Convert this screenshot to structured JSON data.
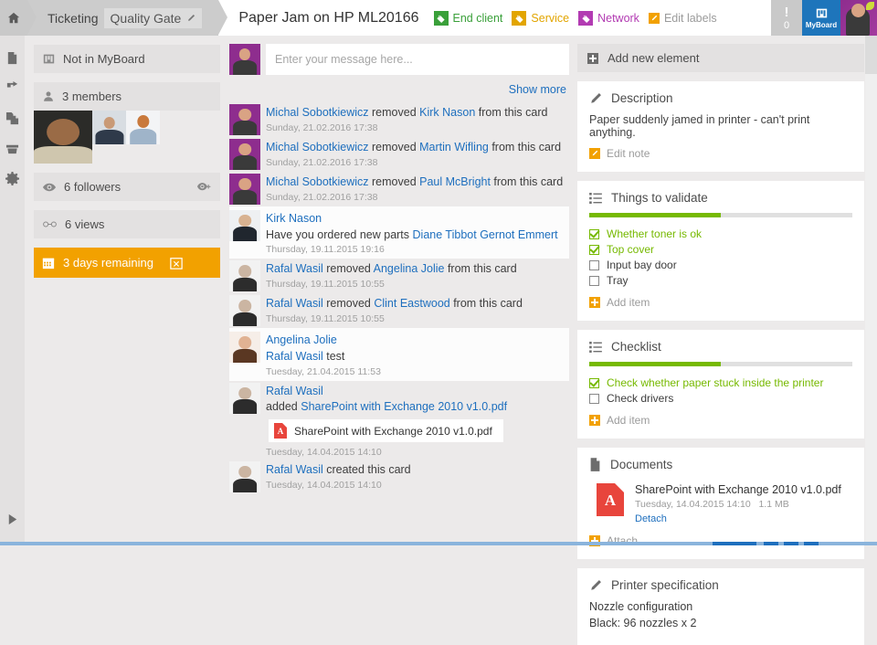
{
  "header": {
    "home_icon": "home-icon",
    "breadcrumb": [
      {
        "label": "Ticketing",
        "type": "plain"
      },
      {
        "label": "Quality Gate",
        "type": "chip",
        "icon": "pencil-icon"
      }
    ],
    "card_title": "Paper Jam on HP ML20166",
    "labels": [
      {
        "text": "End client",
        "color": "#3aa03a",
        "icon": "tag-icon"
      },
      {
        "text": "Service",
        "color": "#e2a500",
        "icon": "tag-icon"
      },
      {
        "text": "Network",
        "color": "#b23bb2",
        "icon": "tag-icon"
      }
    ],
    "edit_labels": {
      "text": "Edit labels",
      "icon": "pencil-icon",
      "color": "#9b9b9b"
    },
    "alerts": {
      "icon": "exclamation-icon",
      "count": "0"
    },
    "myboard": {
      "label": "MyBoard",
      "icon": "board-icon",
      "color": "#1e75bb"
    },
    "user_avatar": "user-avatar"
  },
  "rail": {
    "items": [
      {
        "name": "document-icon"
      },
      {
        "name": "move-arrow-icon"
      },
      {
        "name": "copy-icon"
      },
      {
        "name": "archive-icon"
      },
      {
        "name": "gear-icon"
      }
    ],
    "expand": {
      "name": "play-expand-icon"
    }
  },
  "left": {
    "board_status": {
      "label": "Not in MyBoard",
      "icon": "board-icon"
    },
    "members": {
      "label": "3 members",
      "icon": "person-icon",
      "count": 3
    },
    "followers": {
      "label": "6 followers",
      "icon": "eye-icon",
      "action_icon": "eye-plus-icon"
    },
    "views": {
      "label": "6 views",
      "icon": "glasses-icon"
    },
    "due": {
      "label": "3 days remaining",
      "icon": "calendar-icon",
      "action_icon": "calendar-remove-icon",
      "color": "#f2a100"
    }
  },
  "center": {
    "message_placeholder": "Enter your message here...",
    "message_value": "",
    "show_more": "Show more",
    "feed": [
      {
        "kind": "event",
        "avatar": "michal",
        "parts": [
          {
            "t": "Michal Sobotkiewicz",
            "link": true
          },
          {
            "t": " removed ",
            "link": false
          },
          {
            "t": "Kirk Nason",
            "link": true
          },
          {
            "t": " from this card",
            "link": false
          }
        ],
        "time": "Sunday, 21.02.2016 17:38"
      },
      {
        "kind": "event",
        "avatar": "michal",
        "parts": [
          {
            "t": "Michal Sobotkiewicz",
            "link": true
          },
          {
            "t": " removed ",
            "link": false
          },
          {
            "t": "Martin Wifling",
            "link": true
          },
          {
            "t": " from this card",
            "link": false
          }
        ],
        "time": "Sunday, 21.02.2016 17:38"
      },
      {
        "kind": "event",
        "avatar": "michal",
        "parts": [
          {
            "t": "Michal Sobotkiewicz",
            "link": true
          },
          {
            "t": " removed ",
            "link": false
          },
          {
            "t": "Paul McBright",
            "link": true
          },
          {
            "t": " from this card",
            "link": false
          }
        ],
        "time": "Sunday, 21.02.2016 17:38"
      },
      {
        "kind": "comment",
        "avatar": "kirk",
        "highlight": true,
        "author": "Kirk Nason",
        "parts": [
          {
            "t": "Have you ordered new parts ",
            "link": false
          },
          {
            "t": "Diane Tibbot",
            "link": true
          },
          {
            "t": "   ",
            "link": false
          },
          {
            "t": "Gernot Emmert",
            "link": true
          }
        ],
        "time": "Thursday, 19.11.2015 19:16"
      },
      {
        "kind": "event",
        "avatar": "rafal",
        "parts": [
          {
            "t": "Rafal Wasil",
            "link": true
          },
          {
            "t": " removed ",
            "link": false
          },
          {
            "t": "Angelina Jolie",
            "link": true
          },
          {
            "t": " from this card",
            "link": false
          }
        ],
        "time": "Thursday, 19.11.2015 10:55"
      },
      {
        "kind": "event",
        "avatar": "rafal",
        "parts": [
          {
            "t": "Rafal Wasil",
            "link": true
          },
          {
            "t": " removed ",
            "link": false
          },
          {
            "t": "Clint Eastwood",
            "link": true
          },
          {
            "t": " from this card",
            "link": false
          }
        ],
        "time": "Thursday, 19.11.2015 10:55"
      },
      {
        "kind": "comment",
        "avatar": "angelina",
        "highlight": true,
        "author": "Angelina Jolie",
        "parts": [
          {
            "t": "Rafal Wasil",
            "link": true
          },
          {
            "t": "  test",
            "link": false
          }
        ],
        "time": "Tuesday, 21.04.2015 11:53"
      },
      {
        "kind": "attachment",
        "avatar": "rafal",
        "author": "Rafal Wasil",
        "parts": [
          {
            "t": "added ",
            "link": false
          },
          {
            "t": "SharePoint with Exchange 2010 v1.0.pdf",
            "link": true
          }
        ],
        "attachment_name": "SharePoint with Exchange 2010 v1.0.pdf",
        "time": "Tuesday, 14.04.2015 14:10"
      },
      {
        "kind": "event",
        "avatar": "rafal",
        "parts": [
          {
            "t": "Rafal Wasil",
            "link": true
          },
          {
            "t": " created this card",
            "link": false
          }
        ],
        "time": "Tuesday, 14.04.2015 14:10"
      }
    ]
  },
  "right": {
    "add_new_element": {
      "label": "Add new element",
      "icon": "plus-square-icon"
    },
    "description": {
      "title": "Description",
      "icon": "pencil-icon",
      "text": "Paper suddenly jamed in printer - can't print anything.",
      "edit_label": "Edit note"
    },
    "things_to_validate": {
      "title": "Things to validate",
      "icon": "list-icon",
      "progress_percent": 50,
      "progress_color": "#76b900",
      "items": [
        {
          "label": "Whether toner is ok",
          "checked": true
        },
        {
          "label": "Top cover",
          "checked": true
        },
        {
          "label": "Input bay door",
          "checked": false
        },
        {
          "label": "Tray",
          "checked": false
        }
      ],
      "add_label": "Add item"
    },
    "checklist": {
      "title": "Checklist",
      "icon": "list-icon",
      "progress_percent": 50,
      "progress_color": "#76b900",
      "items": [
        {
          "label": "Check whether paper stuck inside the printer",
          "checked": true
        },
        {
          "label": "Check drivers",
          "checked": false
        }
      ],
      "add_label": "Add item"
    },
    "documents": {
      "title": "Documents",
      "icon": "document-icon",
      "files": [
        {
          "name": "SharePoint with Exchange 2010 v1.0.pdf",
          "date": "Tuesday, 14.04.2015 14:10",
          "size": "1.1 MB",
          "detach_label": "Detach"
        }
      ],
      "attach_label": "Attach"
    },
    "printer_specification": {
      "title": "Printer specification",
      "icon": "pencil-icon",
      "lines": [
        "Nozzle configuration",
        "Black: 96 nozzles x 2"
      ]
    }
  }
}
